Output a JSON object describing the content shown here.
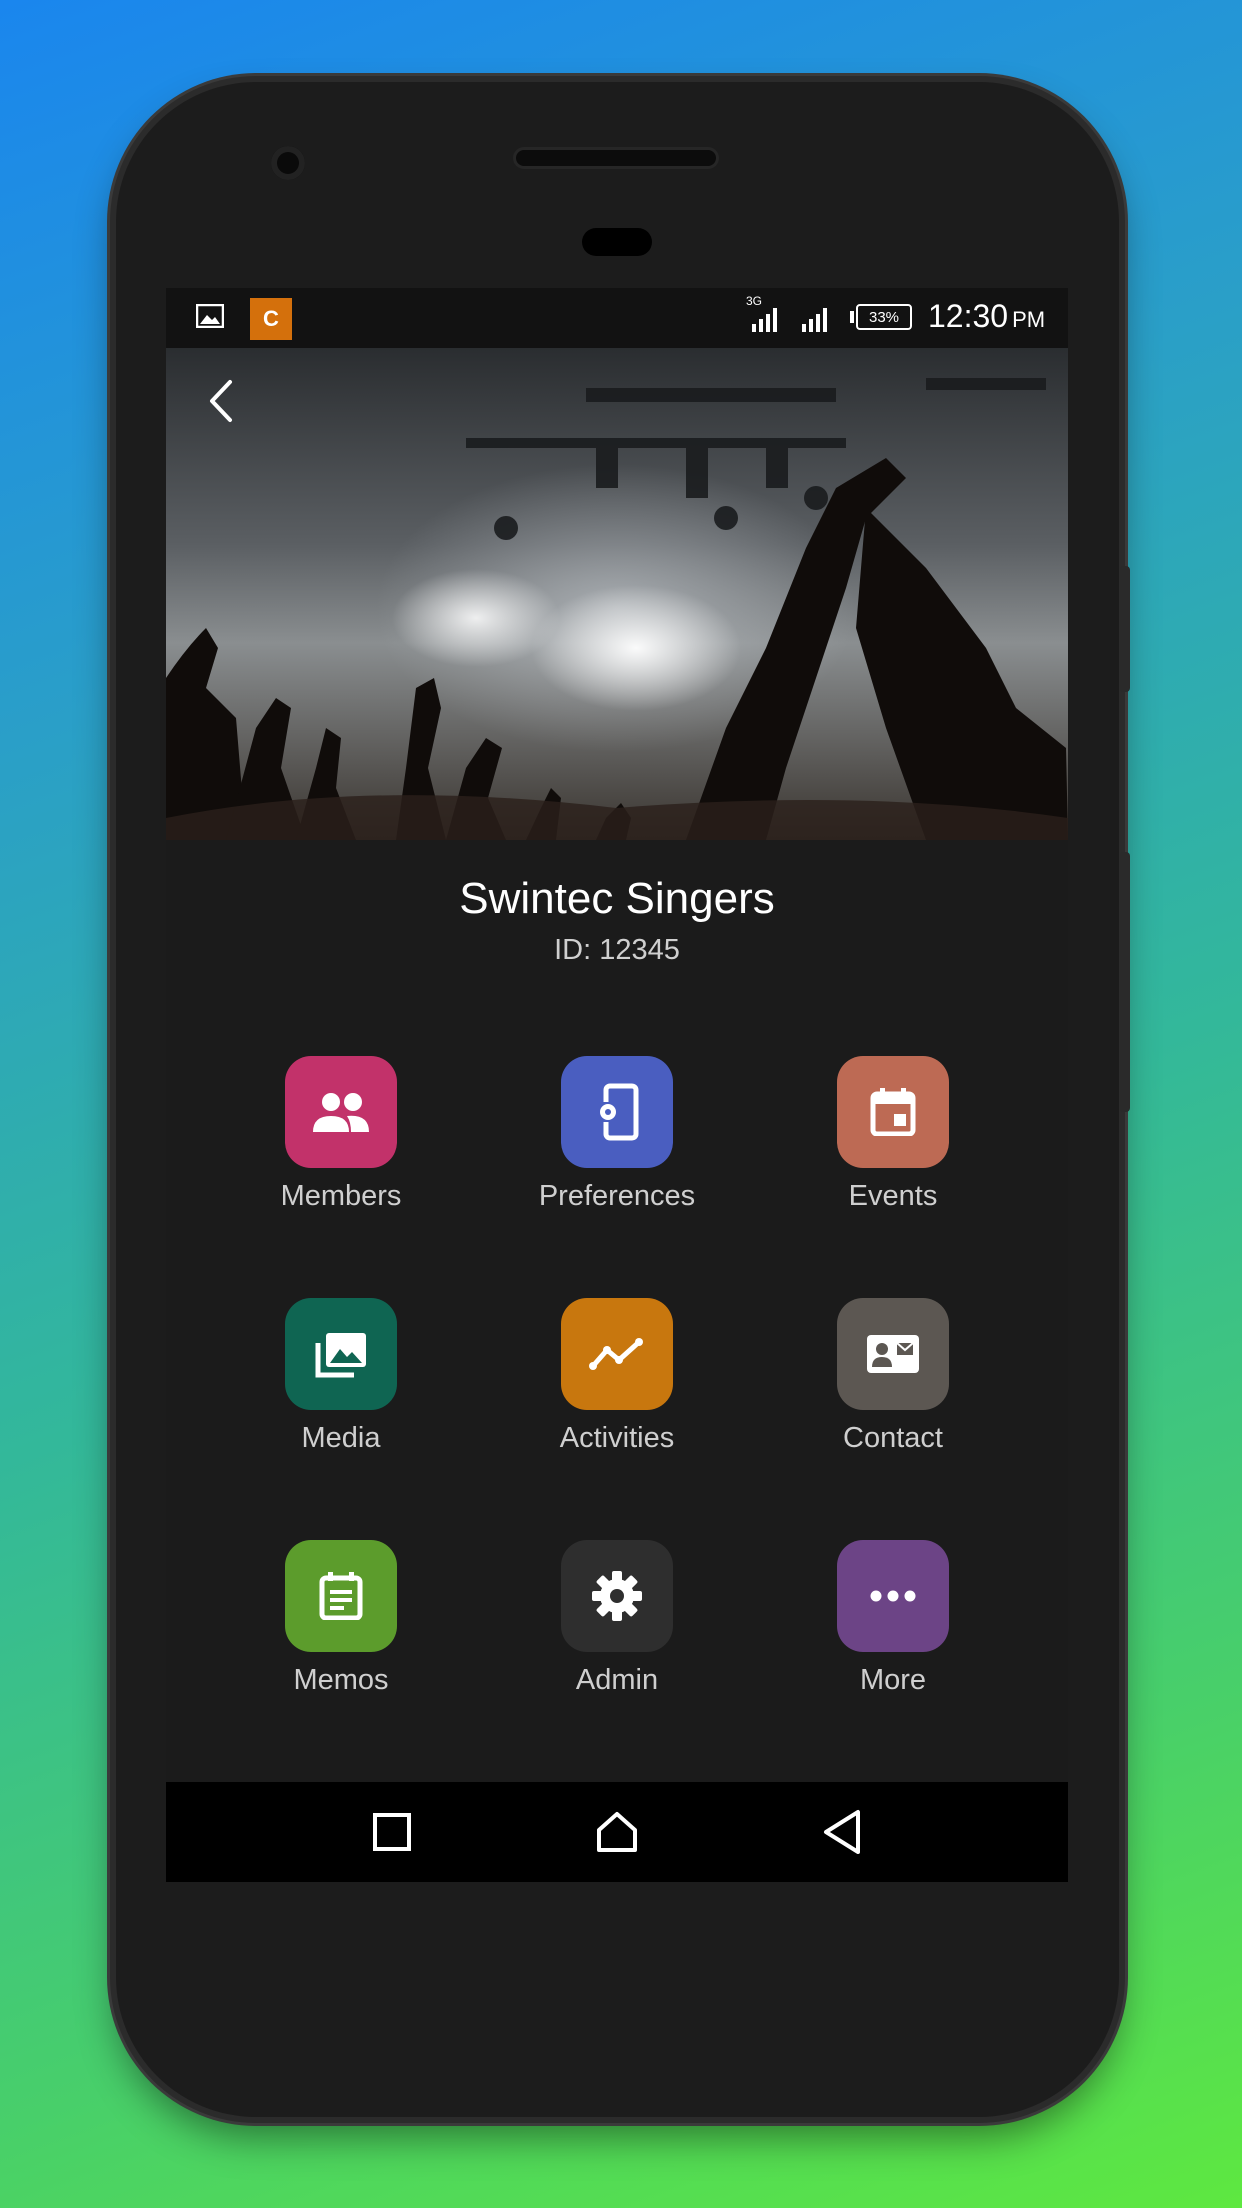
{
  "status_bar": {
    "network_type": "3G",
    "battery": "33%",
    "time": "12:30",
    "ampm": "PM",
    "app_badge": "C"
  },
  "header": {
    "back_icon": "chevron-left-icon",
    "hero_image": "concert-crowd-photo"
  },
  "group": {
    "name": "Swintec Singers",
    "id_text": "ID: 12345"
  },
  "menu": {
    "items": [
      {
        "label": "Members",
        "icon": "people-icon",
        "color": "#c2326a"
      },
      {
        "label": "Preferences",
        "icon": "phone-settings-icon",
        "color": "#4a5ec0"
      },
      {
        "label": "Events",
        "icon": "calendar-icon",
        "color": "#bd6a54"
      },
      {
        "label": "Media",
        "icon": "photo-library-icon",
        "color": "#0f6552"
      },
      {
        "label": "Activities",
        "icon": "trend-line-icon",
        "color": "#c8770e"
      },
      {
        "label": "Contact",
        "icon": "contact-card-icon",
        "color": "#5c5752"
      },
      {
        "label": "Memos",
        "icon": "memo-icon",
        "color": "#5c9c2c"
      },
      {
        "label": "Admin",
        "icon": "gear-icon",
        "color": "#2e2e2e"
      },
      {
        "label": "More",
        "icon": "more-dots-icon",
        "color": "#6c4486"
      }
    ]
  },
  "colors": {
    "background_top": "#1a86ee",
    "background_bottom": "#5ee840",
    "content_bg": "#1b1b1b"
  }
}
